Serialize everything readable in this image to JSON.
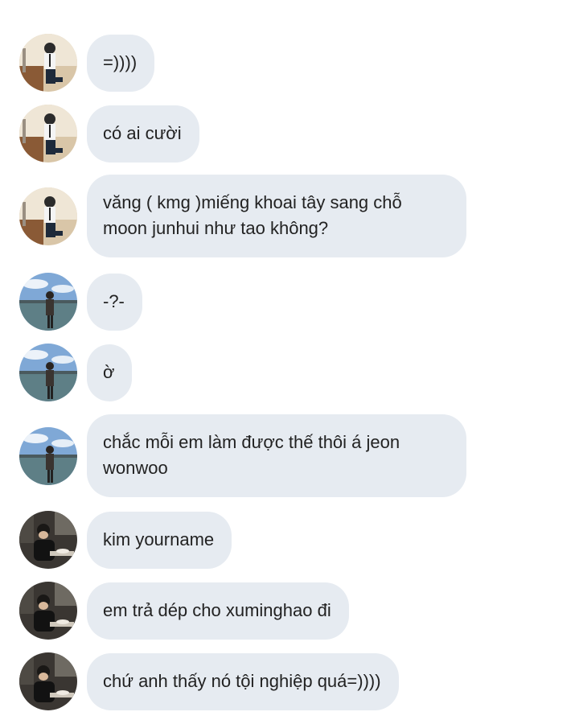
{
  "colors": {
    "background": "#ffffff",
    "bubble": "#e6ebf1",
    "text": "#222222"
  },
  "avatars": {
    "a": "person-sitting-on-ledge-avatar",
    "b": "person-by-waterfront-avatar",
    "c": "person-at-dinner-table-avatar"
  },
  "messages": [
    {
      "avatar": "a",
      "text": "=))))"
    },
    {
      "avatar": "a",
      "text": "có ai cười"
    },
    {
      "avatar": "a",
      "text": "văng ( kmg )miếng khoai tây sang chỗ moon junhui như tao không?"
    },
    {
      "avatar": "b",
      "text": "-?-"
    },
    {
      "avatar": "b",
      "text": "ờ"
    },
    {
      "avatar": "b",
      "text": "chắc mỗi em làm được thế thôi á jeon wonwoo"
    },
    {
      "avatar": "c",
      "text": "kim yourname"
    },
    {
      "avatar": "c",
      "text": "em trả dép cho xuminghao đi"
    },
    {
      "avatar": "c",
      "text": "chứ anh thấy nó tội nghiệp quá=))))"
    }
  ]
}
